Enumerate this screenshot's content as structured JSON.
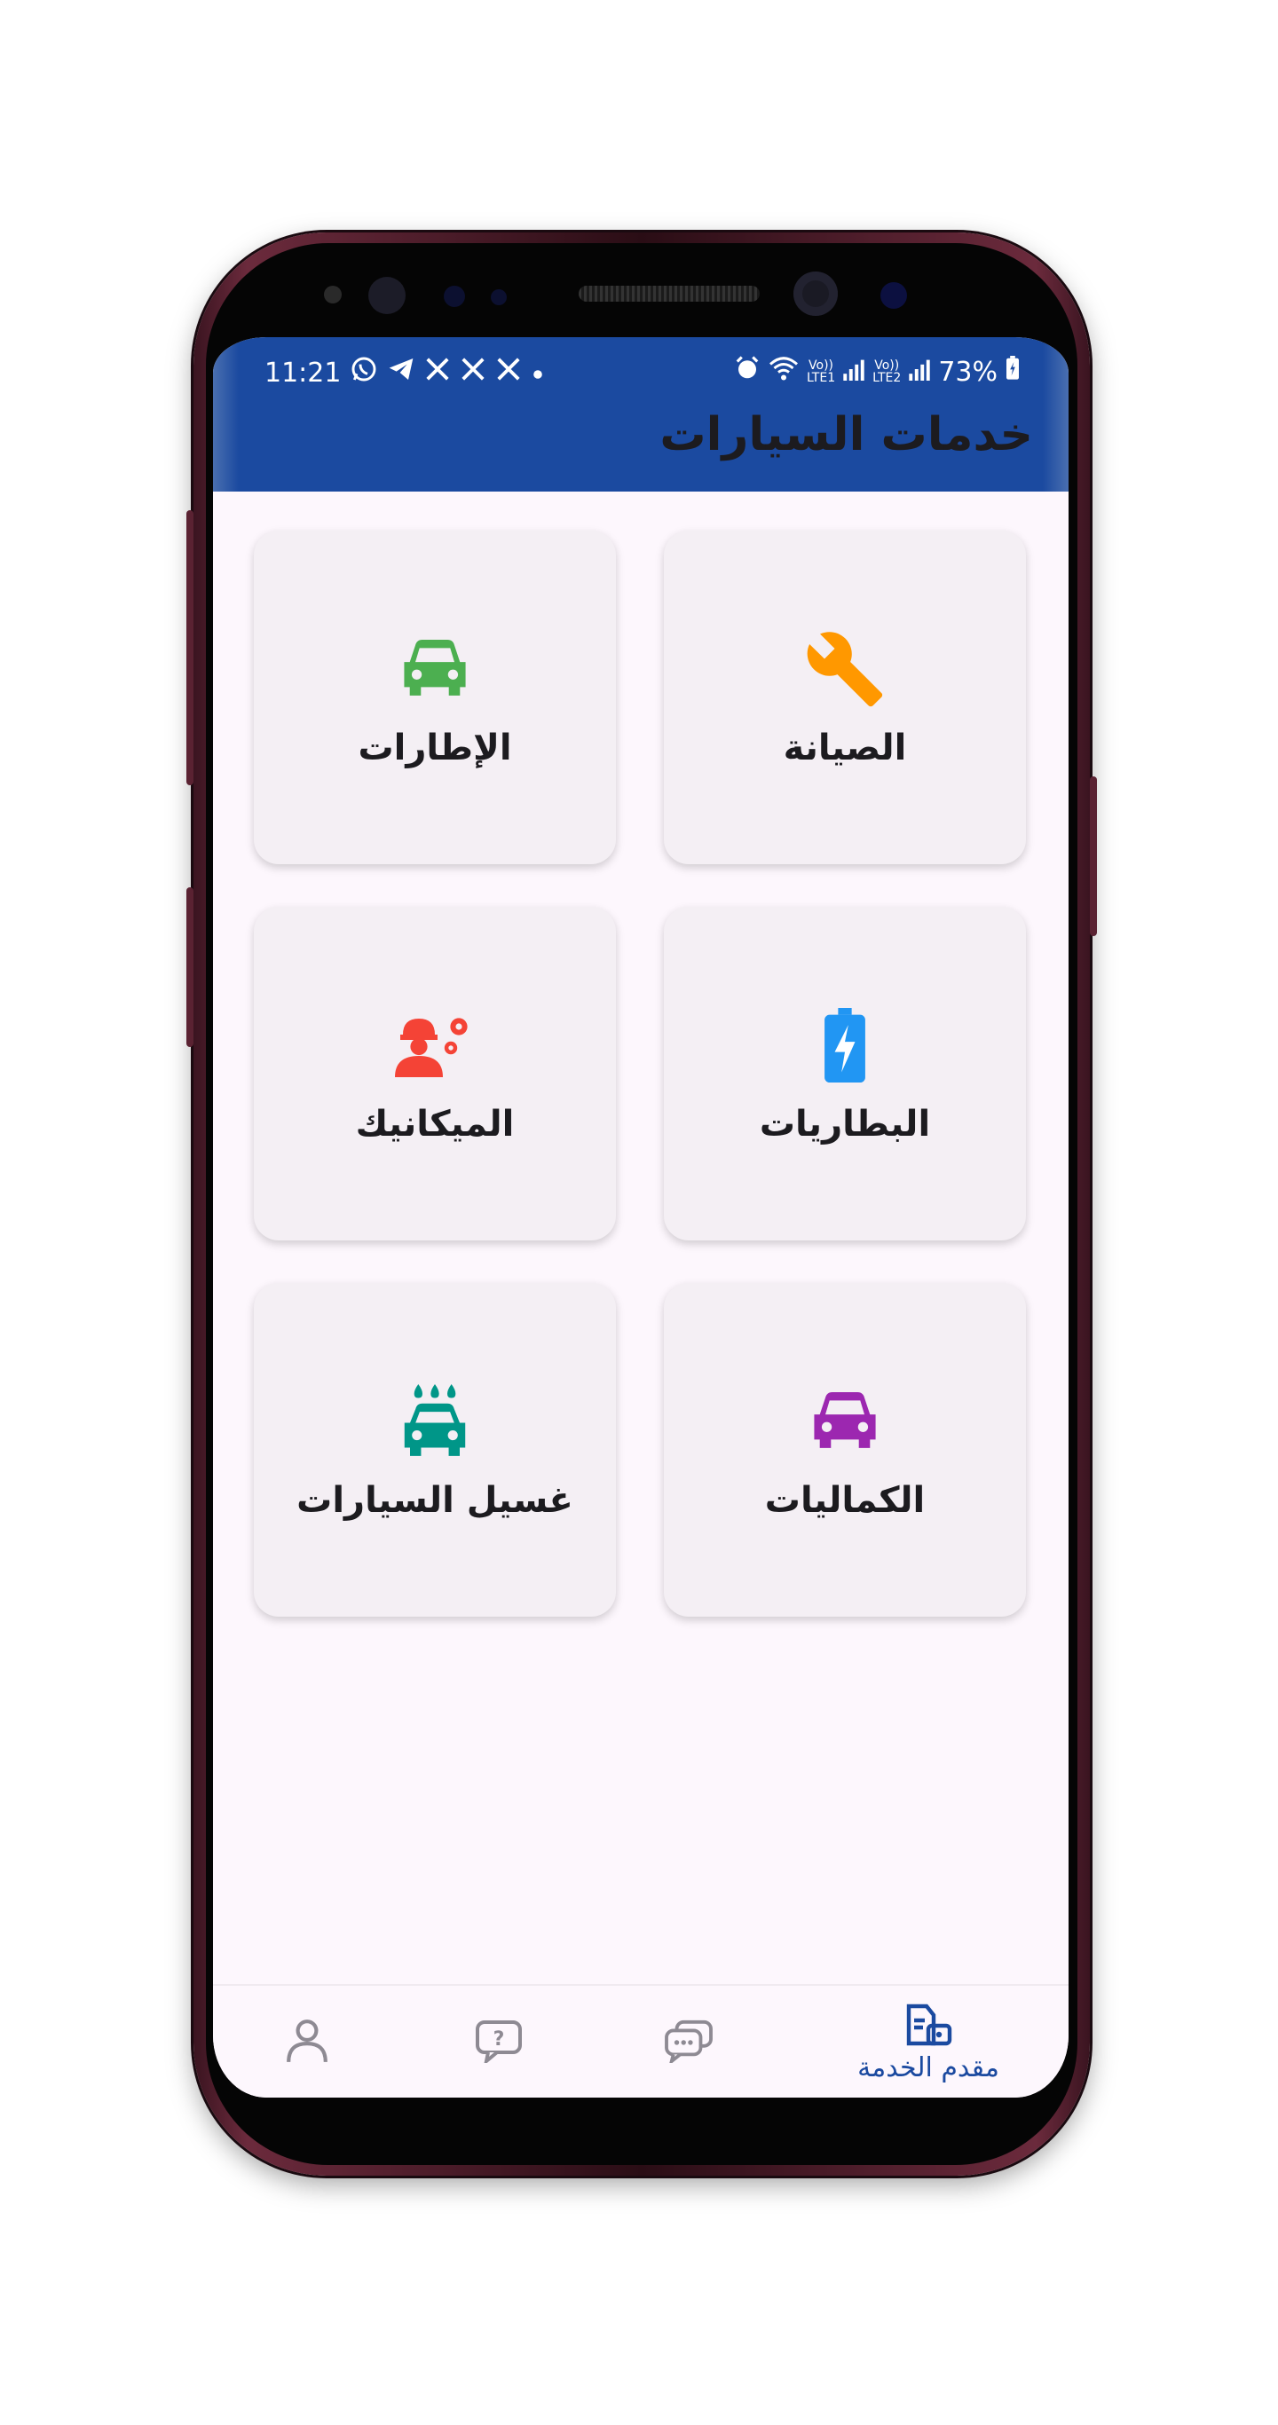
{
  "status_bar": {
    "time": "11:21",
    "battery": "73%",
    "sim1_label": "LTE1",
    "sim2_label": "LTE2",
    "volte_label": "Vo))",
    "notification_icons": [
      "whatsapp-icon",
      "telegram-icon",
      "x-icon",
      "x-icon",
      "x-icon",
      "dot-icon"
    ],
    "status_icons": [
      "alarm-icon",
      "wifi-icon",
      "signal-icon",
      "signal-icon",
      "battery-icon"
    ]
  },
  "app_bar": {
    "title": "خدمات السيارات",
    "color": "#1b4aa0"
  },
  "services": [
    {
      "label": "الصيانة",
      "icon": "wrench-icon",
      "color": "#ff9800"
    },
    {
      "label": "الإطارات",
      "icon": "car-icon",
      "color": "#4caf50"
    },
    {
      "label": "البطاريات",
      "icon": "battery-charging-icon",
      "color": "#2196f3"
    },
    {
      "label": "الميكانيك",
      "icon": "mechanic-icon",
      "color": "#f44336"
    },
    {
      "label": "الكماليات",
      "icon": "car-icon",
      "color": "#9c27b0"
    },
    {
      "label": "غسيل السيارات",
      "icon": "car-wash-icon",
      "color": "#009688"
    }
  ],
  "bottom_nav": {
    "selected": "service-provider",
    "items": [
      {
        "id": "service-provider",
        "label": "مقدم الخدمة",
        "icon": "service-provider-icon"
      },
      {
        "id": "chat",
        "label": "",
        "icon": "chat-icon"
      },
      {
        "id": "help",
        "label": "",
        "icon": "help-icon"
      },
      {
        "id": "profile",
        "label": "",
        "icon": "person-icon"
      }
    ]
  }
}
